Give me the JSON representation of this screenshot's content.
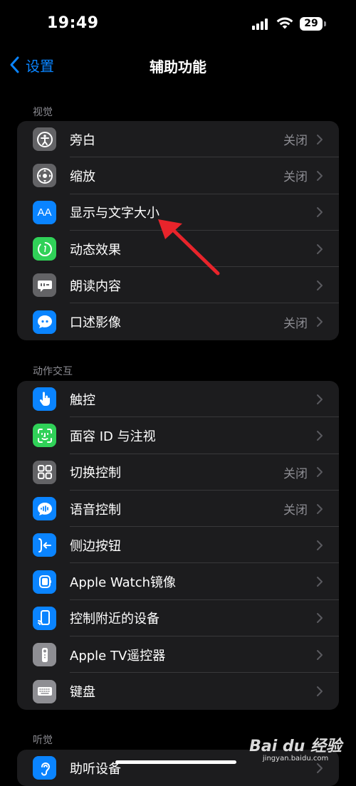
{
  "status": {
    "time": "19:49",
    "battery": "29"
  },
  "nav": {
    "back_label": "设置",
    "title": "辅助功能"
  },
  "sections": [
    {
      "header": "视觉",
      "rows": [
        {
          "label": "旁白",
          "value": "关闭",
          "icon": "voiceover-icon",
          "color": "#636366"
        },
        {
          "label": "缩放",
          "value": "关闭",
          "icon": "zoom-icon",
          "color": "#636366"
        },
        {
          "label": "显示与文字大小",
          "value": "",
          "icon": "text-size-icon",
          "color": "#0a84ff"
        },
        {
          "label": "动态效果",
          "value": "",
          "icon": "motion-icon",
          "color": "#30d158"
        },
        {
          "label": "朗读内容",
          "value": "",
          "icon": "spoken-content-icon",
          "color": "#636366"
        },
        {
          "label": "口述影像",
          "value": "关闭",
          "icon": "audio-description-icon",
          "color": "#0a84ff"
        }
      ]
    },
    {
      "header": "动作交互",
      "rows": [
        {
          "label": "触控",
          "value": "",
          "icon": "touch-icon",
          "color": "#0a84ff"
        },
        {
          "label": "面容 ID 与注视",
          "value": "",
          "icon": "face-id-icon",
          "color": "#30d158"
        },
        {
          "label": "切换控制",
          "value": "关闭",
          "icon": "switch-control-icon",
          "color": "#636366"
        },
        {
          "label": "语音控制",
          "value": "关闭",
          "icon": "voice-control-icon",
          "color": "#0a84ff"
        },
        {
          "label": "侧边按钮",
          "value": "",
          "icon": "side-button-icon",
          "color": "#0a84ff"
        },
        {
          "label": "Apple Watch镜像",
          "value": "",
          "icon": "watch-mirroring-icon",
          "color": "#0a84ff"
        },
        {
          "label": "控制附近的设备",
          "value": "",
          "icon": "nearby-devices-icon",
          "color": "#0a84ff"
        },
        {
          "label": "Apple TV遥控器",
          "value": "",
          "icon": "tv-remote-icon",
          "color": "#8e8e93"
        },
        {
          "label": "键盘",
          "value": "",
          "icon": "keyboard-icon",
          "color": "#8e8e93"
        }
      ]
    },
    {
      "header": "听觉",
      "rows": [
        {
          "label": "助听设备",
          "value": "",
          "icon": "hearing-devices-icon",
          "color": "#0a84ff"
        }
      ]
    }
  ],
  "watermark": {
    "logo": "Bai du 经验",
    "url": "jingyan.baidu.com"
  }
}
